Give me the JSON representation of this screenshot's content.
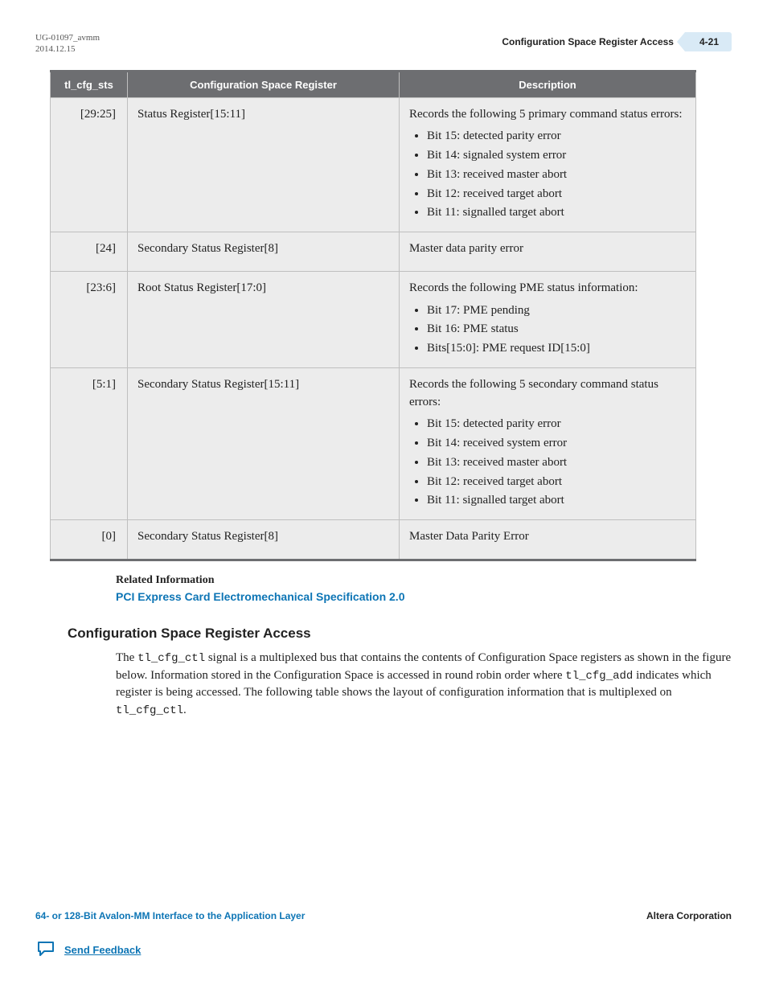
{
  "header": {
    "doc_id": "UG-01097_avmm",
    "date": "2014.12.15",
    "title": "Configuration Space Register Access",
    "page_num": "4-21"
  },
  "table": {
    "headers": {
      "c0": "tl_cfg_sts",
      "c1": "Configuration Space Register",
      "c2": "Description"
    },
    "rows": [
      {
        "bits": "[29:25]",
        "reg": "Status Register[15:11]",
        "desc_lead": "Records the following 5 primary command status errors:",
        "bullets": [
          "Bit 15: detected parity error",
          "Bit 14: signaled system error",
          "Bit 13: received master abort",
          "Bit 12: received target abort",
          "Bit 11: signalled target abort"
        ]
      },
      {
        "bits": "[24]",
        "reg": "Secondary Status Register[8]",
        "desc_lead": "Master data parity error",
        "bullets": []
      },
      {
        "bits": "[23:6]",
        "reg": "Root Status Register[17:0]",
        "desc_lead": "Records the following PME status information:",
        "bullets": [
          "Bit 17: PME pending",
          "Bit 16: PME status",
          "Bits[15:0]: PME request ID[15:0]"
        ]
      },
      {
        "bits": "[5:1]",
        "reg": "Secondary Status Register[15:11]",
        "desc_lead": "Records the following 5 secondary command status errors:",
        "bullets": [
          "Bit 15: detected parity error",
          "Bit 14: received system error",
          "Bit 13: received master abort",
          "Bit 12: received target abort",
          "Bit 11: signalled target abort"
        ]
      },
      {
        "bits": "[0]",
        "reg": "Secondary Status Register[8]",
        "desc_lead": "Master Data Parity Error",
        "bullets": []
      }
    ]
  },
  "related": {
    "label": "Related Information",
    "link_text": "PCI Express Card Electromechanical Specification 2.0"
  },
  "section": {
    "heading": "Configuration Space Register Access",
    "para_parts": {
      "p1": "The ",
      "code1": "tl_cfg_ctl",
      "p2": " signal is a multiplexed bus that contains the contents of Configuration Space registers as shown in the figure below. Information stored in the Configuration Space is accessed in round robin order where ",
      "code2": "tl_cfg_add",
      "p3": " indicates which register is being accessed. The following table shows the layout of configuration information that is multiplexed on ",
      "code3": "tl_cfg_ctl",
      "p4": "."
    }
  },
  "footer": {
    "left": "64- or 128-Bit Avalon-MM Interface to the Application Layer",
    "right": "Altera Corporation",
    "feedback": "Send Feedback"
  }
}
